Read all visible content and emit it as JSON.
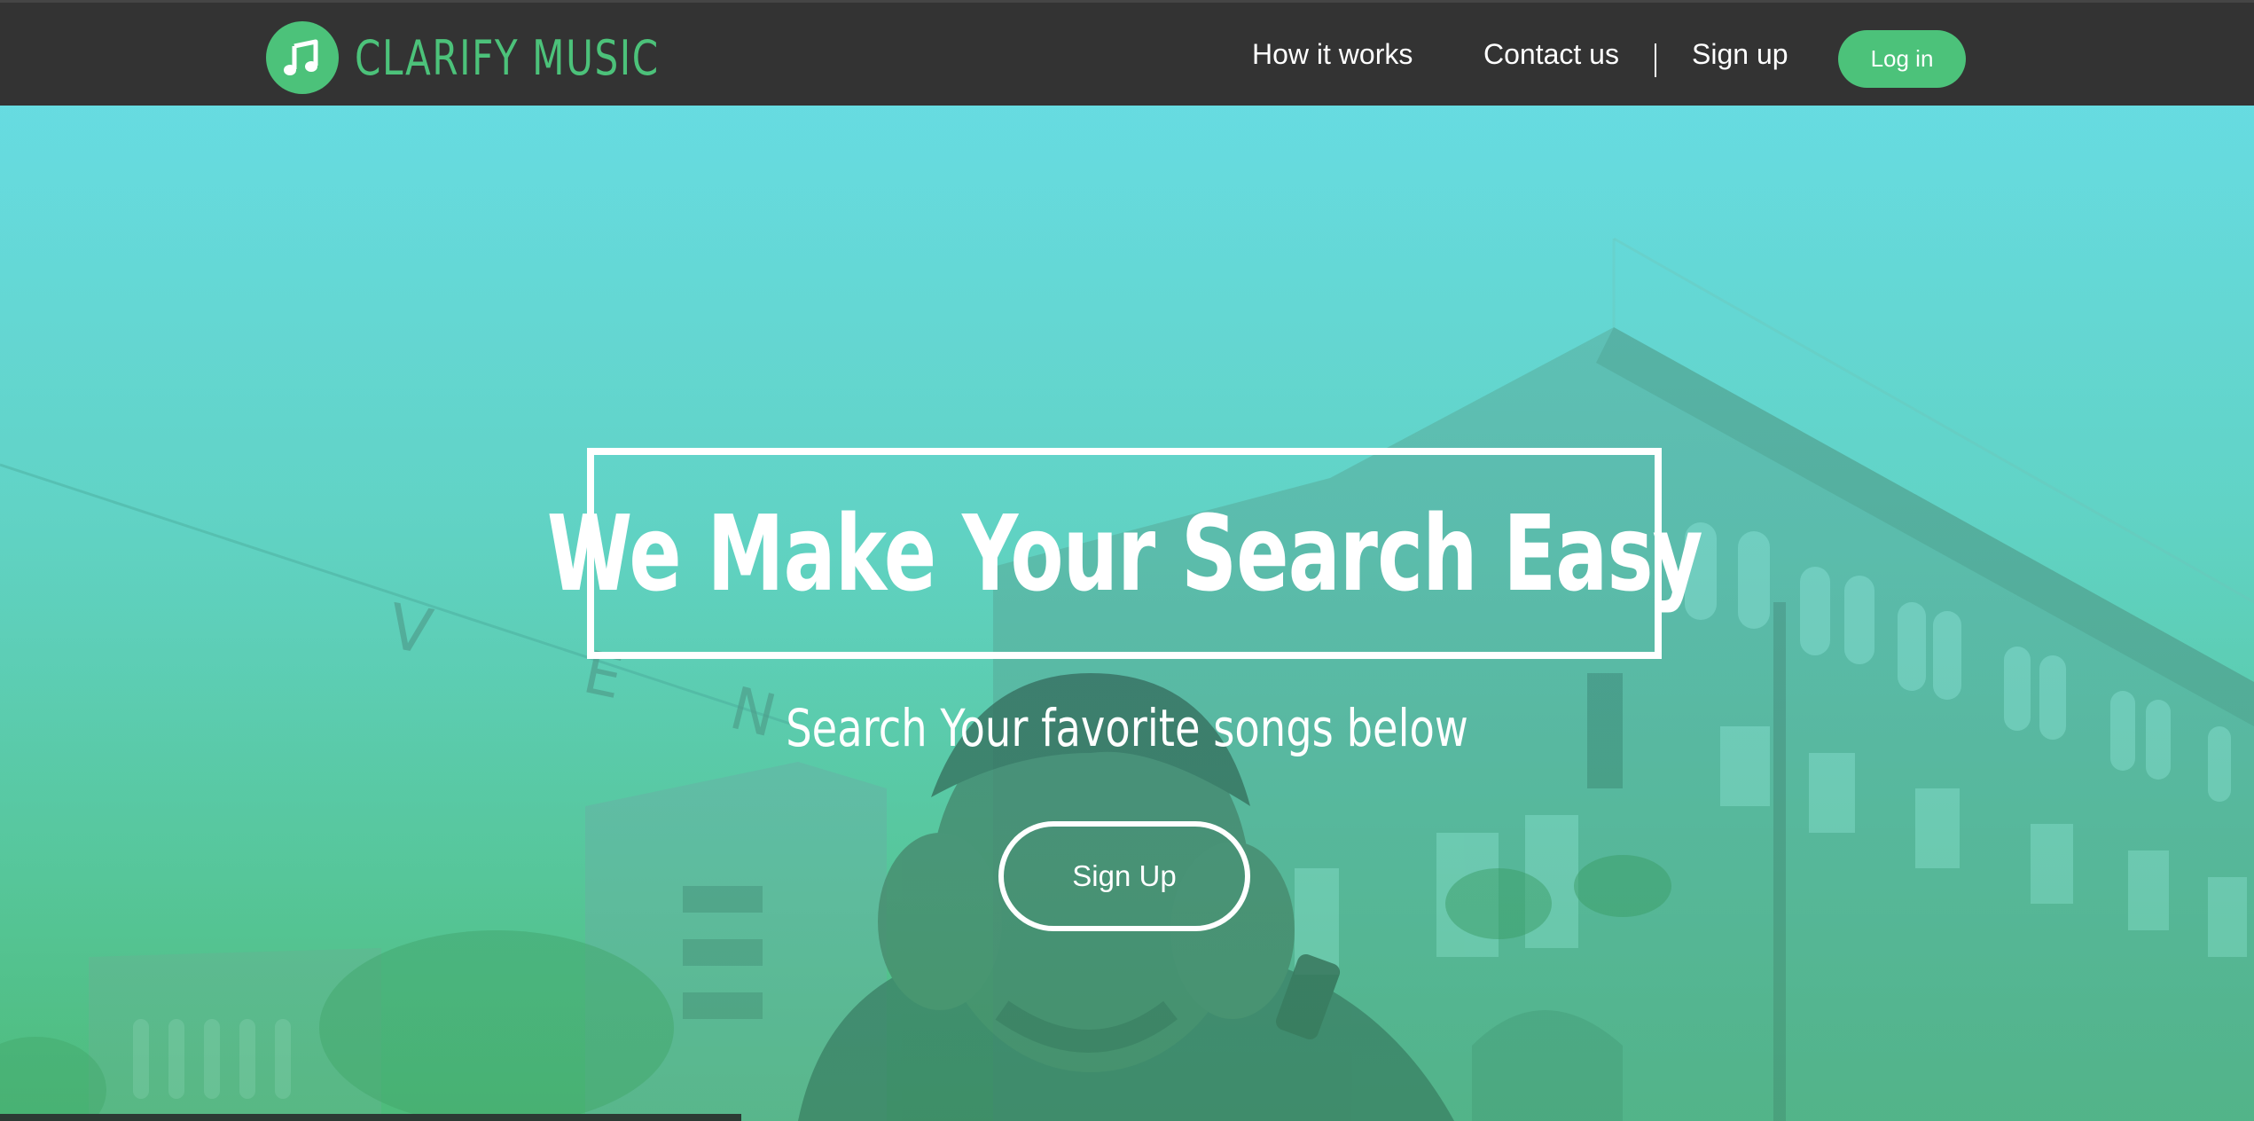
{
  "brand": {
    "name": "CLARIFY MUSIC",
    "icon": "music-note-icon",
    "accent_color": "#4cc27a"
  },
  "nav": {
    "how_it_works": "How it works",
    "contact_us": "Contact us",
    "sign_up": "Sign up",
    "log_in": "Log in"
  },
  "hero": {
    "headline": "We Make Your Search Easy",
    "subtitle": "Search Your favorite songs below",
    "cta_label": "Sign Up",
    "background": "street-photo-man-with-headphones"
  },
  "colors": {
    "navbar_bg": "#333333",
    "hero_overlay": "#5fd6cf",
    "text": "#ffffff"
  }
}
